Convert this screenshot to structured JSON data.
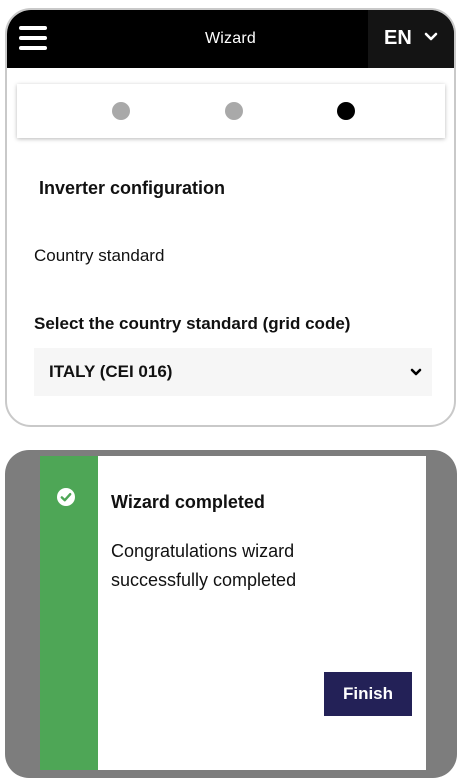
{
  "header": {
    "title": "Wizard",
    "language": "EN"
  },
  "stepper": {
    "total_steps": 3,
    "current_step": 3
  },
  "form": {
    "section_title": "Inverter configuration",
    "field_label": "Country standard",
    "select_label": "Select the country standard (grid code)",
    "select_value": "ITALY (CEI 016)"
  },
  "modal": {
    "title": "Wizard completed",
    "message": "Congratulations wizard successfully completed",
    "finish_label": "Finish"
  },
  "colors": {
    "topbar": "#000000",
    "success_strip": "#4ea656",
    "finish_button": "#232157",
    "overlay": "#7d7d7d"
  }
}
